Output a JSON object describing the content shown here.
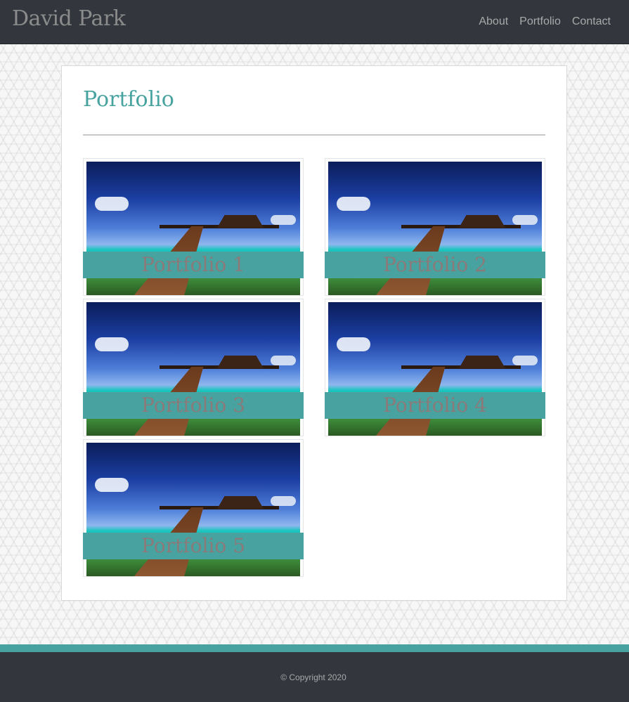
{
  "navbar": {
    "brand": "David Park",
    "links": [
      "About",
      "Portfolio",
      "Contact"
    ]
  },
  "main": {
    "title": "Portfolio",
    "items": [
      {
        "caption": "Portfolio 1",
        "image": "overwater-bungalow-photo"
      },
      {
        "caption": "Portfolio 2",
        "image": "overwater-bungalow-photo"
      },
      {
        "caption": "Portfolio 3",
        "image": "overwater-bungalow-photo"
      },
      {
        "caption": "Portfolio 4",
        "image": "overwater-bungalow-photo"
      },
      {
        "caption": "Portfolio 5",
        "image": "overwater-bungalow-photo"
      }
    ]
  },
  "footer": {
    "copyright": "© Copyright 2020"
  },
  "colors": {
    "navbar_bg": "#33373d",
    "accent": "#47a2a0",
    "brand_text": "#8b8b8b",
    "caption_text": "#8b7a7a"
  }
}
